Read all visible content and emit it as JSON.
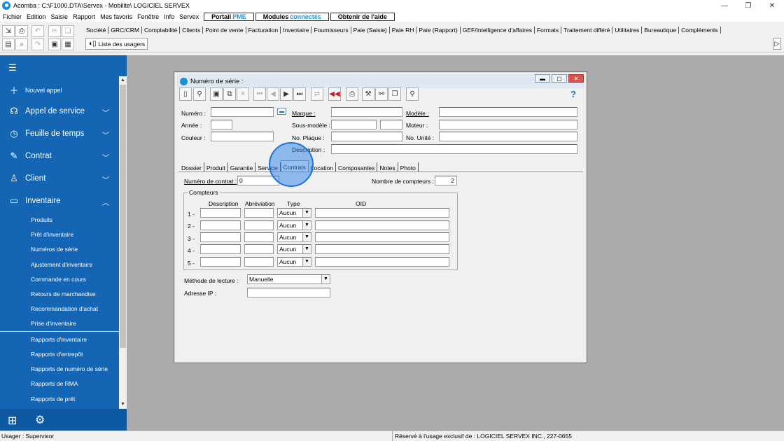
{
  "window": {
    "title": "Acomba : C:\\F1000.DTA\\Servex - Mobilite\\  LOGICIEL SERVEX",
    "controls": [
      "—",
      "❐",
      "✕"
    ]
  },
  "menu": {
    "items": [
      "Fichier",
      "Edition",
      "Saisie",
      "Rapport",
      "Mes favoris",
      "Fenêtre",
      "Info",
      "Servex"
    ],
    "portail_label": "Portail",
    "portail_highlight": "PME",
    "modules_label": "Modules",
    "modules_highlight": "connectés",
    "aide_label": "Obtenir de l'aide"
  },
  "toolbar": {
    "modules": [
      "Société",
      "GRC/CRM",
      "Comptabilité",
      "Clients",
      "Point de vente",
      "Facturation",
      "Inventaire",
      "Fournisseurs",
      "Paie (Saisie)",
      "Paie RH",
      "Paie (Rapport)",
      "GEF/Intelligence d'affaires",
      "Formats",
      "Traitement différé",
      "Utilitaires",
      "Bureautique",
      "Compléments"
    ],
    "users_button": "Liste des usagers"
  },
  "sidebar": {
    "new_call": "Nouvel appel",
    "sections": [
      "Appel de service",
      "Feuille de temps",
      "Contrat",
      "Client",
      "Inventaire"
    ],
    "inventory_items": [
      "Produits",
      "Prêt d'inventaire",
      "Numéros de série",
      "Ajustement d'inventaire",
      "Commande en cours",
      "Retours de marchandise",
      "Recommandation d'achat",
      "Prise d'inventaire",
      "Rapports d'inventaire",
      "Rapports d'entrepôt",
      "Rapports de numéro de série",
      "Rapports de RMA",
      "Rapports de prêt"
    ]
  },
  "dialog": {
    "title": "Numéro de série :",
    "help": "?",
    "labels": {
      "numero": "Numéro :",
      "marque": "Marque :",
      "modele": "Modèle :",
      "annee": "Année :",
      "sous_modele": "Sous-modèle :",
      "moteur": "Moteur :",
      "couleur": "Couleur :",
      "no_plaque": "No. Plaque :",
      "no_unite": "No. Unité :",
      "description": "Description :"
    },
    "tabs": [
      "Dossier",
      "Produit",
      "Garantie",
      "Service",
      "Contrats",
      "Location",
      "Composantes",
      "Notes",
      "Photo"
    ],
    "active_tab": "Contrats",
    "contrats": {
      "numero_contrat_label": "Numéro de contrat :",
      "numero_contrat_value": "0",
      "nombre_compteurs_label": "Nombre de compteurs :",
      "nombre_compteurs_value": "2",
      "compteurs_title": "Compteurs",
      "columns": [
        "Description",
        "Abréviation",
        "Type",
        "OID"
      ],
      "rows": [
        {
          "index": "1 -",
          "type": "Aucun"
        },
        {
          "index": "2 -",
          "type": "Aucun"
        },
        {
          "index": "3 -",
          "type": "Aucun"
        },
        {
          "index": "4 -",
          "type": "Aucun"
        },
        {
          "index": "5 -",
          "type": "Aucun"
        }
      ],
      "methode_label": "Méthode de lecture :",
      "methode_value": "Manuelle",
      "adresse_ip_label": "Adresse IP :"
    }
  },
  "status": {
    "user": "Usager : Supervisor",
    "reserved": "Réservé à l'usage exclusif de : LOGICIEL SERVEX INC., 227-0655"
  },
  "colors": {
    "sidebar": "#1466b5",
    "workspace": "#ababab",
    "accent": "#2a8fd6"
  }
}
